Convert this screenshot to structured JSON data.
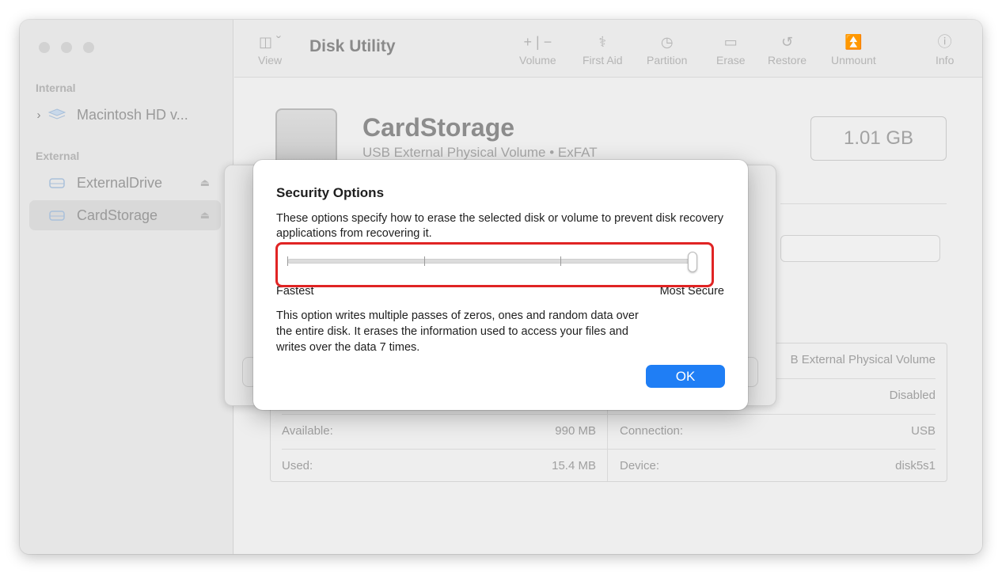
{
  "toolbar": {
    "view_label": "View",
    "title": "Disk Utility",
    "volume_label": "Volume",
    "first_aid_label": "First Aid",
    "partition_label": "Partition",
    "erase_label": "Erase",
    "restore_label": "Restore",
    "unmount_label": "Unmount",
    "info_label": "Info"
  },
  "sidebar": {
    "internal_label": "Internal",
    "external_label": "External",
    "items": [
      {
        "label": "Macintosh HD v...",
        "section": "internal"
      },
      {
        "label": "ExternalDrive",
        "section": "external"
      },
      {
        "label": "CardStorage",
        "section": "external",
        "selected": true
      }
    ]
  },
  "volume": {
    "name": "CardStorage",
    "subtitle": "USB External Physical Volume • ExFAT",
    "capacity": "1.01 GB"
  },
  "info": {
    "rows": [
      {
        "right_value": "B External Physical Volume"
      },
      {
        "right_value": "Disabled"
      },
      {
        "left_label": "Available:",
        "left_value": "990 MB",
        "right_label": "Connection:",
        "right_value": "USB"
      },
      {
        "left_label": "Used:",
        "left_value": "15.4 MB",
        "right_label": "Device:",
        "right_value": "disk5s1"
      }
    ]
  },
  "dialog": {
    "title": "Security Options",
    "description": "These options specify how to erase the selected disk or volume to prevent disk recovery applications from recovering it.",
    "slider": {
      "min_label": "Fastest",
      "max_label": "Most Secure",
      "level": 3,
      "max_level": 3
    },
    "detail": "This option writes multiple passes of zeros, ones and random data over the entire disk. It erases the information used to access your files and writes over the data 7 times.",
    "ok_label": "OK",
    "accent_color": "#1f7ef5"
  }
}
